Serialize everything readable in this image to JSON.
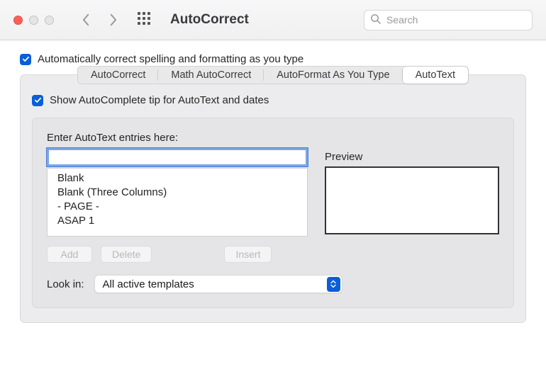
{
  "window": {
    "title": "AutoCorrect",
    "search_placeholder": "Search"
  },
  "checkboxes": {
    "auto_correct": "Automatically correct spelling and formatting as you type",
    "show_autocomplete": "Show AutoComplete tip for AutoText and dates"
  },
  "tabs": {
    "autocorrect": "AutoCorrect",
    "math": "Math AutoCorrect",
    "autoformat": "AutoFormat As You Type",
    "autotext": "AutoText"
  },
  "autotext": {
    "entries_label": "Enter AutoText entries here:",
    "input_value": "",
    "preview_label": "Preview",
    "entries": {
      "e0": "Blank",
      "e1": "Blank (Three Columns)",
      "e2": "- PAGE -",
      "e3": "ASAP 1"
    },
    "buttons": {
      "add": "Add",
      "delete": "Delete",
      "insert": "Insert"
    },
    "look_in_label": "Look in:",
    "look_in_value": "All active templates"
  }
}
